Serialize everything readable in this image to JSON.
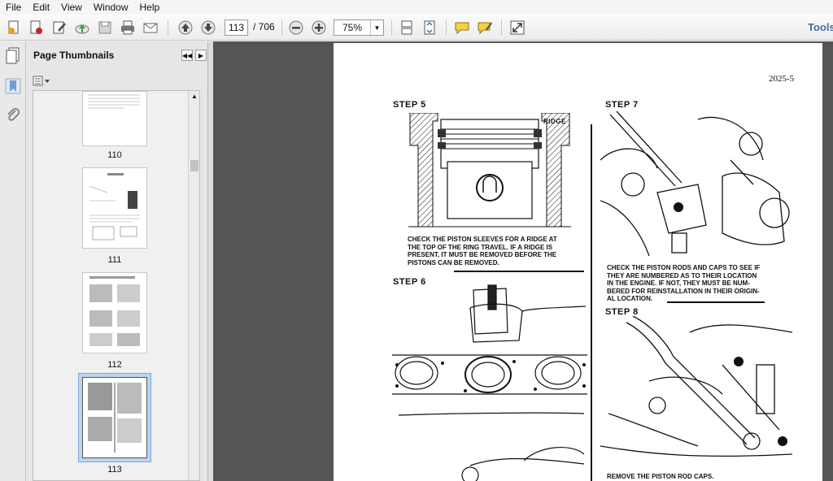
{
  "menu": [
    "File",
    "Edit",
    "View",
    "Window",
    "Help"
  ],
  "toolbar": {
    "current_page": "113",
    "total_pages": "/ 706",
    "zoom": "75%",
    "tools_label": "Tools"
  },
  "thumbnails": {
    "panel_title": "Page Thumbnails",
    "pages": [
      {
        "label": "110"
      },
      {
        "label": "111"
      },
      {
        "label": "112"
      },
      {
        "label": "113"
      }
    ],
    "selected_page": "113"
  },
  "document": {
    "page_number": "2025-5",
    "steps": {
      "step5": {
        "title": "STEP 5",
        "caption_lines": [
          "CHECK THE PISTON SLEEVES FOR A RIDGE AT",
          "THE TOP OF THE RING TRAVEL. IF A RIDGE IS",
          "PRESENT, IT MUST BE REMOVED BEFORE THE",
          "PISTONS CAN BE REMOVED."
        ],
        "callout": "RIDGE"
      },
      "step6": {
        "title": "STEP 6"
      },
      "step7": {
        "title": "STEP 7",
        "caption_lines": [
          "CHECK THE PISTON RODS AND CAPS TO SEE IF",
          "THEY ARE NUMBERED AS TO THEIR LOCATION",
          "IN THE ENGINE. IF NOT, THEY MUST BE NUM-",
          "BERED FOR REINSTALLATION IN THEIR ORIGIN-",
          "AL LOCATION."
        ]
      },
      "step8": {
        "title": "STEP 8",
        "caption_lines": [
          "REMOVE THE PISTON ROD CAPS."
        ]
      }
    }
  },
  "colors": {
    "doc_background": "#555555",
    "selection": "#bcd5ee",
    "tools_link": "#3f6f9c"
  }
}
